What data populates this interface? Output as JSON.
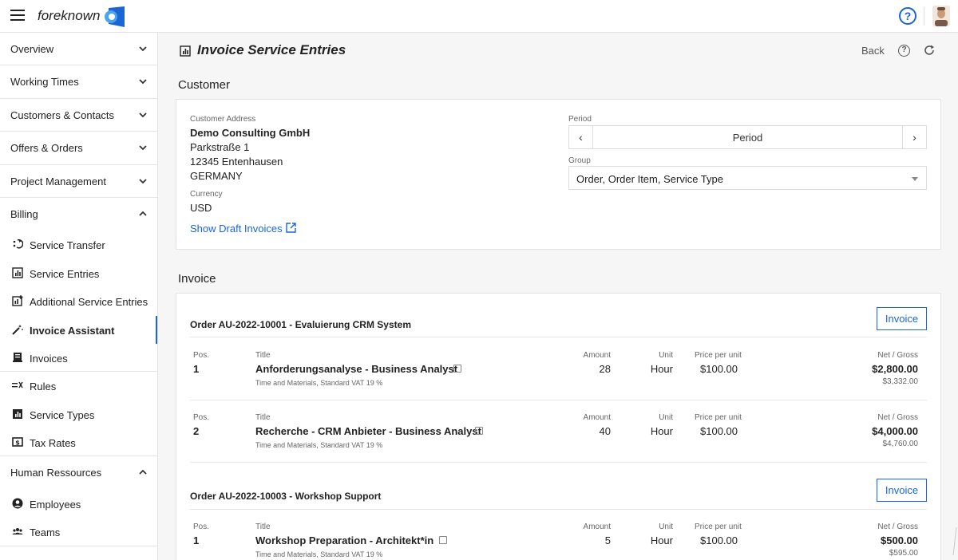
{
  "app": {
    "brand": "foreknown"
  },
  "sidebar": {
    "groups_top": [
      {
        "label": "Overview",
        "chevron": "chevron-down-icon"
      },
      {
        "label": "Working Times",
        "chevron": "chevron-down-icon"
      },
      {
        "label": "Customers & Contacts",
        "chevron": "chevron-down-icon"
      },
      {
        "label": "Offers & Orders",
        "chevron": "chevron-down-icon"
      },
      {
        "label": "Project Management",
        "chevron": "chevron-down-icon"
      },
      {
        "label": "Billing",
        "chevron": "chevron-up-icon"
      }
    ],
    "billing_items": [
      {
        "label": "Service Transfer",
        "icon": "transfer-icon"
      },
      {
        "label": "Service Entries",
        "icon": "chart-icon"
      },
      {
        "label": "Additional Service Entries",
        "icon": "chart-plus-icon"
      },
      {
        "label": "Invoice Assistant",
        "icon": "magic-wand-icon",
        "active": true
      },
      {
        "label": "Invoices",
        "icon": "invoice-icon"
      },
      {
        "label": "Rules",
        "icon": "rules-icon"
      },
      {
        "label": "Service Types",
        "icon": "bar-chart-icon"
      },
      {
        "label": "Tax Rates",
        "icon": "money-icon"
      }
    ],
    "hr_group": {
      "label": "Human Ressources",
      "chevron": "chevron-up-icon"
    },
    "hr_items": [
      {
        "label": "Employees",
        "icon": "user-icon"
      },
      {
        "label": "Teams",
        "icon": "team-icon"
      }
    ]
  },
  "header": {
    "title": "Invoice Service Entries",
    "back_label": "Back",
    "help_glyph": "?"
  },
  "customer": {
    "section_title": "Customer",
    "address_label": "Customer Address",
    "company": "Demo Consulting GmbH",
    "street": "Parkstraße 1",
    "city": "12345 Entenhausen",
    "country": "GERMANY",
    "currency_label": "Currency",
    "currency": "USD",
    "draft_link": "Show Draft Invoices",
    "period_label": "Period",
    "period_value": "Period",
    "group_label": "Group",
    "group_value": "Order, Order Item, Service Type"
  },
  "invoice": {
    "section_title": "Invoice",
    "col_pos": "Pos.",
    "col_title": "Title",
    "col_amount": "Amount",
    "col_unit": "Unit",
    "col_price": "Price per unit",
    "col_net": "Net / Gross",
    "invoice_btn": "Invoice",
    "orders": [
      {
        "title": "Order AU-2022-10001 - Evaluierung CRM System",
        "items": [
          {
            "pos": "1",
            "title": "Anforderungsanalyse - Business Analyst",
            "sub": "Time and Materials, Standard VAT 19 %",
            "amount": "28",
            "unit": "Hour",
            "price": "$100.00",
            "net": "$2,800.00",
            "gross": "$3,332.00"
          },
          {
            "pos": "2",
            "title": "Recherche - CRM Anbieter - Business Analyst",
            "sub": "Time and Materials, Standard VAT 19 %",
            "amount": "40",
            "unit": "Hour",
            "price": "$100.00",
            "net": "$4,000.00",
            "gross": "$4,760.00"
          }
        ]
      },
      {
        "title": "Order AU-2022-10003 - Workshop Support",
        "items": [
          {
            "pos": "1",
            "title": "Workshop Preparation - Architekt*in",
            "sub": "Time and Materials, Standard VAT 19 %",
            "amount": "5",
            "unit": "Hour",
            "price": "$100.00",
            "net": "$500.00",
            "gross": "$595.00"
          }
        ]
      }
    ]
  },
  "colors": {
    "accent": "#1a66d6",
    "background": "#f6f6f6",
    "border": "#e2e2e2"
  }
}
